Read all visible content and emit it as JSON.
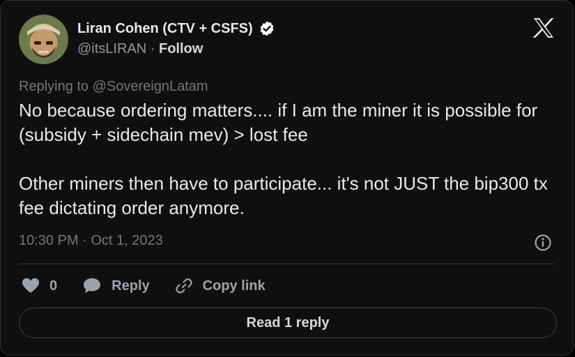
{
  "author": {
    "display_name": "Liran Cohen (CTV + CSFS)",
    "handle": "@itsLIRAN",
    "separator": " · ",
    "follow_label": "Follow",
    "avatar_icon": "avatar-photo",
    "verified_icon": "verified-badge-icon"
  },
  "reply_context": {
    "prefix": "Replying to ",
    "handle": "@SovereignLatam"
  },
  "tweet": {
    "paragraphs": [
      "No because ordering matters.... if I am the miner it is possible for (subsidy + sidechain mev) > lost fee",
      "Other miners then have to participate... it's not JUST the bip300 tx fee dictating order anymore."
    ],
    "timestamp": "10:30 PM · Oct 1, 2023"
  },
  "actions": {
    "like_count": "0",
    "reply_label": "Reply",
    "copy_link_label": "Copy link"
  },
  "read_replies_label": "Read 1 reply",
  "colors": {
    "background": "#0f0f0f",
    "text_primary": "#e7e9ea",
    "text_secondary": "#71767b",
    "verified": "#ffffff"
  }
}
